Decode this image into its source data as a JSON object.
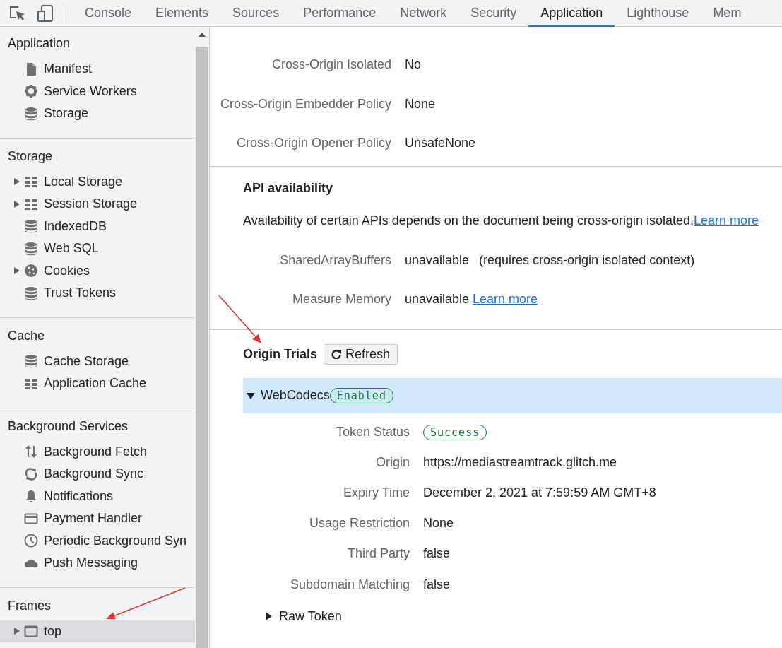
{
  "toolbar": {
    "tabs": [
      {
        "label": "Console",
        "selected": false
      },
      {
        "label": "Elements",
        "selected": false
      },
      {
        "label": "Sources",
        "selected": false
      },
      {
        "label": "Performance",
        "selected": false
      },
      {
        "label": "Network",
        "selected": false
      },
      {
        "label": "Security",
        "selected": false
      },
      {
        "label": "Application",
        "selected": true
      },
      {
        "label": "Lighthouse",
        "selected": false
      },
      {
        "label": "Mem",
        "selected": false
      }
    ]
  },
  "sidebar": {
    "sections": [
      {
        "title": "Application",
        "items": [
          {
            "label": "Manifest",
            "expandable": false,
            "selected": false
          },
          {
            "label": "Service Workers",
            "expandable": false,
            "selected": false
          },
          {
            "label": "Storage",
            "expandable": false,
            "selected": false
          }
        ]
      },
      {
        "title": "Storage",
        "items": [
          {
            "label": "Local Storage",
            "expandable": true,
            "selected": false
          },
          {
            "label": "Session Storage",
            "expandable": true,
            "selected": false
          },
          {
            "label": "IndexedDB",
            "expandable": false,
            "selected": false
          },
          {
            "label": "Web SQL",
            "expandable": false,
            "selected": false
          },
          {
            "label": "Cookies",
            "expandable": true,
            "selected": false
          },
          {
            "label": "Trust Tokens",
            "expandable": false,
            "selected": false
          }
        ]
      },
      {
        "title": "Cache",
        "items": [
          {
            "label": "Cache Storage",
            "expandable": false,
            "selected": false
          },
          {
            "label": "Application Cache",
            "expandable": false,
            "selected": false
          }
        ]
      },
      {
        "title": "Background Services",
        "items": [
          {
            "label": "Background Fetch",
            "expandable": false,
            "selected": false
          },
          {
            "label": "Background Sync",
            "expandable": false,
            "selected": false
          },
          {
            "label": "Notifications",
            "expandable": false,
            "selected": false
          },
          {
            "label": "Payment Handler",
            "expandable": false,
            "selected": false
          },
          {
            "label": "Periodic Background Syn",
            "expandable": false,
            "selected": false
          },
          {
            "label": "Push Messaging",
            "expandable": false,
            "selected": false
          }
        ]
      },
      {
        "title": "Frames",
        "items": [
          {
            "label": "top",
            "expandable": true,
            "selected": true
          }
        ]
      }
    ]
  },
  "security": {
    "rows": [
      {
        "label": "Cross-Origin Isolated",
        "value": "No"
      },
      {
        "label": "Cross-Origin Embedder Policy",
        "value": "None"
      },
      {
        "label": "Cross-Origin Opener Policy",
        "value": "UnsafeNone"
      }
    ]
  },
  "api_availability": {
    "title": "API availability",
    "description": "Availability of certain APIs depends on the document being cross-origin isolated.",
    "description_link": "Learn more",
    "rows": [
      {
        "label": "SharedArrayBuffers",
        "value": "unavailable",
        "note": "(requires cross-origin isolated context)"
      },
      {
        "label": "Measure Memory",
        "value": "unavailable",
        "link": "Learn more"
      }
    ]
  },
  "origin_trials": {
    "title": "Origin Trials",
    "refresh_button": "Refresh",
    "trial": {
      "name": "WebCodecs",
      "status": "Enabled",
      "expanded": true,
      "rows": [
        {
          "label": "Token Status",
          "value": "Success",
          "kind": "badge"
        },
        {
          "label": "Origin",
          "value": "https://mediastreamtrack.glitch.me",
          "kind": "text"
        },
        {
          "label": "Expiry Time",
          "value": "December 2, 2021 at 7:59:59 AM GMT+8",
          "kind": "text"
        },
        {
          "label": "Usage Restriction",
          "value": "None",
          "kind": "text"
        },
        {
          "label": "Third Party",
          "value": "false",
          "kind": "text"
        },
        {
          "label": "Subdomain Matching",
          "value": "false",
          "kind": "text"
        }
      ],
      "raw_token": {
        "label": "Raw Token",
        "expanded": false
      }
    }
  },
  "annotations": [
    {
      "kind": "arrow"
    },
    {
      "kind": "arrow"
    }
  ]
}
